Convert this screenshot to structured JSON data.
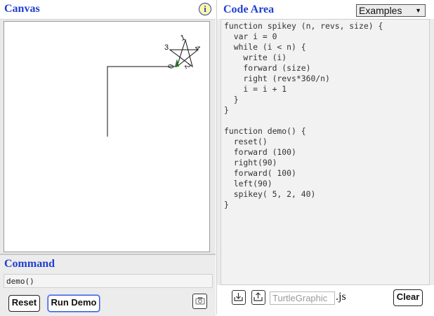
{
  "canvas": {
    "title": "Canvas",
    "info_label": "i",
    "turtle_color": "#1f7a1f",
    "star_labels": [
      "0",
      "1",
      "2",
      "3",
      "4"
    ]
  },
  "command": {
    "title": "Command",
    "value": "demo()",
    "reset_label": "Reset",
    "run_demo_label": "Run Demo",
    "camera_icon": "camera-icon"
  },
  "code": {
    "title": "Code Area",
    "examples_selected": "Examples",
    "lines": "function spikey (n, revs, size) {\n  var i = 0\n  while (i < n) {\n    write (i)\n    forward (size)\n    right (revs*360/n)\n    i = i + 1\n  }\n}\n\nfunction demo() {\n  reset()\n  forward (100)\n  right(90)\n  forward( 100)\n  left(90)\n  spikey( 5, 2, 40)\n}",
    "download_icon": "download-icon",
    "upload_icon": "upload-icon",
    "filename_placeholder": "TurtleGraphic",
    "extension": ".js",
    "clear_label": "Clear"
  },
  "colors": {
    "title_blue": "#1f3fcf",
    "panel_gray": "#ececec"
  }
}
